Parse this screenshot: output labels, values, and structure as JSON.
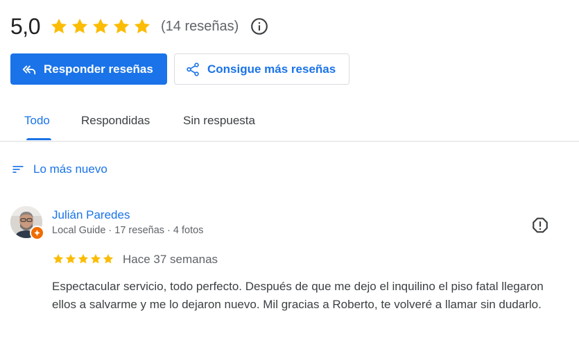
{
  "summary": {
    "rating": "5,0",
    "stars_filled": 5,
    "review_count": "(14 reseñas)"
  },
  "actions": {
    "reply_label": "Responder reseñas",
    "get_more_label": "Consigue más reseñas"
  },
  "tabs": [
    {
      "label": "Todo",
      "active": true
    },
    {
      "label": "Respondidas",
      "active": false
    },
    {
      "label": "Sin respuesta",
      "active": false
    }
  ],
  "sort": {
    "label": "Lo más nuevo"
  },
  "review": {
    "author": "Julián Paredes",
    "meta": "Local Guide · 17 reseñas · 4 fotos",
    "rating": 5,
    "time": "Hace 37 semanas",
    "text": "Espectacular servicio, todo perfecto. Después de que me dejo el inquilino el piso fatal llegaron ellos a salvarme y me lo dejaron nuevo. Mil gracias a Roberto, te volveré a llamar sin dudarlo."
  },
  "colors": {
    "accent": "#1a73e8",
    "star": "#fbbc04",
    "local_guide_badge": "#ef6c00"
  }
}
